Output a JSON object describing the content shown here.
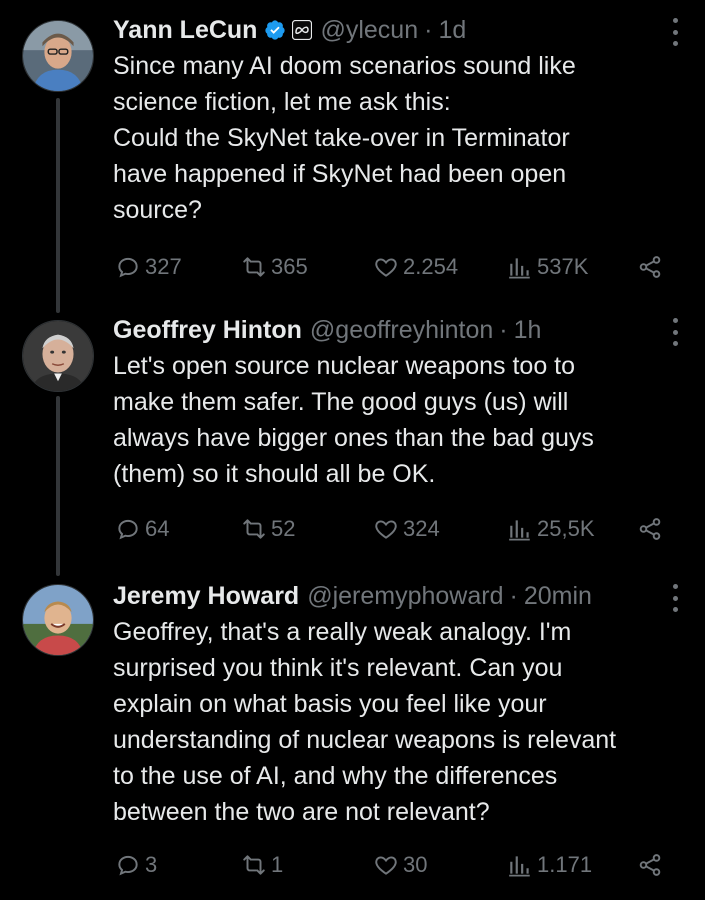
{
  "tweets": [
    {
      "name": "Yann LeCun",
      "handle": "@ylecun",
      "dot": "·",
      "time": "1d",
      "verified": true,
      "affiliation_icon": "meta-icon",
      "lines": [
        "Since many AI doom scenarios sound like",
        "science fiction, let me ask this:",
        "Could the SkyNet take-over in Terminator",
        "have happened if SkyNet had been open",
        "source?"
      ],
      "replies": "327",
      "reposts": "365",
      "likes": "2.254",
      "views": "537K"
    },
    {
      "name": "Geoffrey Hinton",
      "handle": "@geoffreyhinton",
      "dot": "·",
      "time": "1h",
      "verified": false,
      "lines": [
        "Let's open source nuclear weapons too to",
        "make them safer. The good guys (us) will",
        "always have bigger ones than the bad guys",
        "(them) so it should all be OK."
      ],
      "replies": "64",
      "reposts": "52",
      "likes": "324",
      "views": "25,5K"
    },
    {
      "name": "Jeremy Howard",
      "handle": "@jeremyphoward",
      "dot": "·",
      "time": "20min",
      "verified": false,
      "lines": [
        "Geoffrey, that's a really weak analogy. I'm",
        "surprised you think it's relevant. Can you",
        "explain on what basis you feel like your",
        "understanding of nuclear weapons is relevant",
        "to the use of AI, and why the differences",
        "between the two are not relevant?"
      ],
      "replies": "3",
      "reposts": "1",
      "likes": "30",
      "views": "1.171"
    }
  ],
  "colors": {
    "background": "#000000",
    "text": "#e7e9ea",
    "muted": "#71767b",
    "verified": "#1d9bf0",
    "thread_line": "#333639"
  }
}
